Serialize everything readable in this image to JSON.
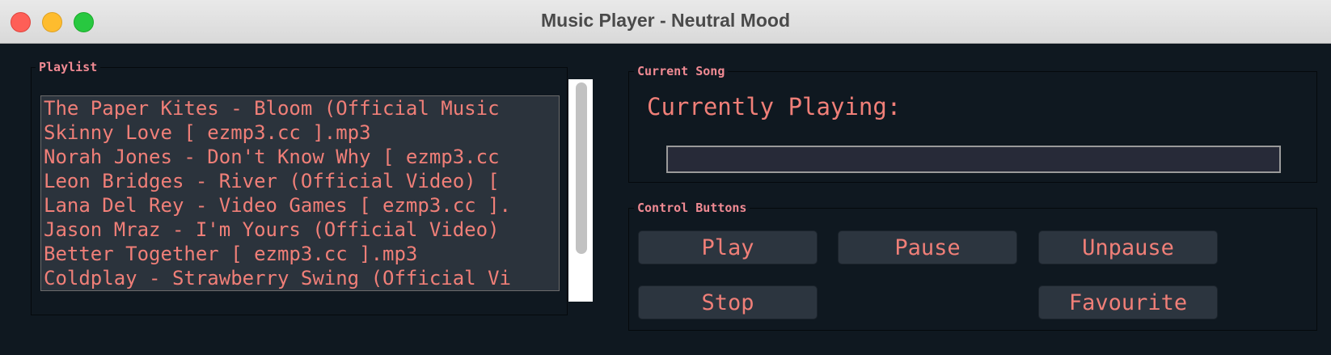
{
  "window": {
    "title": "Music Player - Neutral Mood"
  },
  "playlist": {
    "label": "Playlist",
    "songs": [
      "The Paper Kites - Bloom (Official Music",
      "Skinny Love [ ezmp3.cc ].mp3",
      "Norah Jones - Don't Know Why [ ezmp3.cc",
      "Leon Bridges - River (Official Video) [",
      "Lana Del Rey - Video Games [ ezmp3.cc ].",
      "Jason Mraz - I'm Yours (Official Video)",
      "Better Together [ ezmp3.cc ].mp3",
      "Coldplay - Strawberry Swing (Official Vi"
    ]
  },
  "current_song": {
    "label": "Current Song",
    "playing_label": "Currently Playing:",
    "progress": 0
  },
  "controls": {
    "label": "Control Buttons",
    "play": "Play",
    "pause": "Pause",
    "unpause": "Unpause",
    "stop": "Stop",
    "favourite": "Favourite"
  },
  "colors": {
    "background": "#0f1820",
    "accent_text": "#f07f78",
    "frame_label": "#f08a93",
    "listbox_bg": "#2b333c",
    "button_bg": "#2c353f"
  }
}
